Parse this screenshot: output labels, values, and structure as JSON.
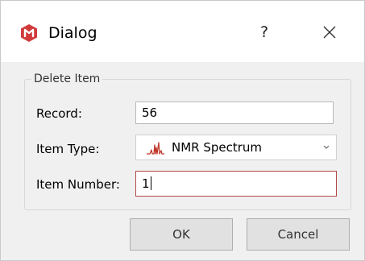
{
  "window": {
    "title": "Dialog",
    "help_label": "?",
    "app_icon": "app-logo-icon",
    "close_icon": "close-icon",
    "accent_color": "#d23b3b"
  },
  "group": {
    "title": "Delete Item"
  },
  "fields": {
    "record": {
      "label": "Record:",
      "value": "56"
    },
    "item_type": {
      "label": "Item Type:",
      "value": "NMR Spectrum",
      "icon": "nmr-spectrum-icon"
    },
    "item_number": {
      "label": "Item Number:",
      "value": "1"
    }
  },
  "buttons": {
    "ok": "OK",
    "cancel": "Cancel"
  }
}
